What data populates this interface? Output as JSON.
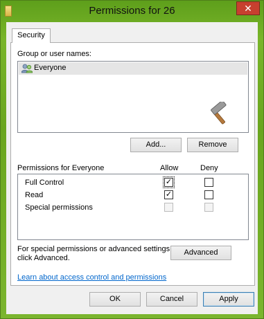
{
  "window": {
    "title": "Permissions for 26",
    "close_glyph": "✕"
  },
  "tabs": [
    {
      "label": "Security"
    }
  ],
  "group_section": {
    "label": "Group or user names:",
    "users": [
      {
        "name": "Everyone",
        "icon": "users-group-icon",
        "selected": true
      }
    ]
  },
  "buttons": {
    "add": "Add...",
    "remove": "Remove",
    "advanced": "Advanced",
    "ok": "OK",
    "cancel": "Cancel",
    "apply": "Apply"
  },
  "permissions": {
    "header": "Permissions for Everyone",
    "allow_header": "Allow",
    "deny_header": "Deny",
    "rows": [
      {
        "name": "Full Control",
        "allow": true,
        "deny": false,
        "disabled": false
      },
      {
        "name": "Read",
        "allow": true,
        "deny": false,
        "disabled": false
      },
      {
        "name": "Special permissions",
        "allow": false,
        "deny": false,
        "disabled": true
      }
    ]
  },
  "advanced_note": {
    "line1": "For special permissions or advanced settings,",
    "line2": "click Advanced."
  },
  "learn_link": "Learn about access control and permissions",
  "colors": {
    "titlebar": "#79b52a",
    "close": "#c7402f",
    "link": "#0066cc"
  }
}
